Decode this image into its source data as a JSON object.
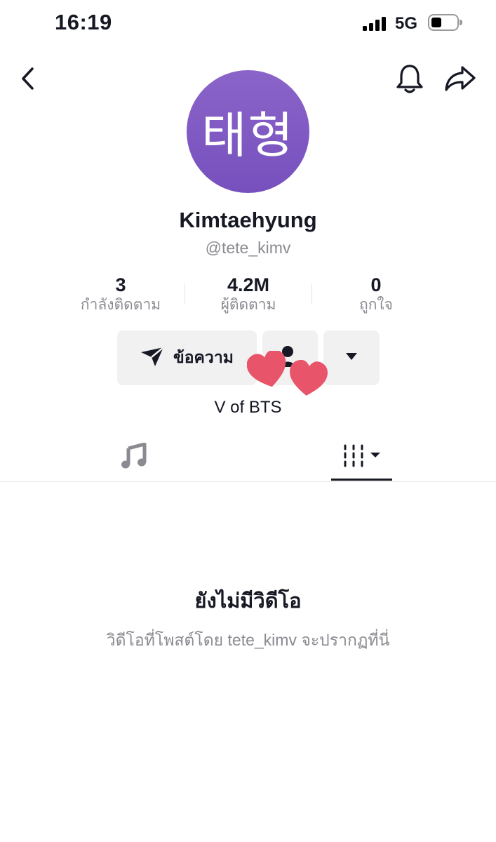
{
  "status_bar": {
    "time": "16:19",
    "network": "5G",
    "icons": [
      "signal-bars-icon",
      "battery-icon"
    ]
  },
  "header": {
    "icons": [
      "back-chevron-icon",
      "bell-icon",
      "share-arrow-icon"
    ]
  },
  "profile": {
    "avatar_text": "태형",
    "avatar_color": "#7d57c2",
    "display_name": "Kimtaehyung",
    "handle": "@tete_kimv",
    "bio": "V of BTS"
  },
  "stats": [
    {
      "value": "3",
      "label": "กำลังติดตาม"
    },
    {
      "value": "4.2M",
      "label": "ผู้ติดตาม"
    },
    {
      "value": "0",
      "label": "ถูกใจ"
    }
  ],
  "actions": {
    "message_label": "ข้อความ",
    "icons": [
      "paper-plane-icon",
      "follow-person-icon",
      "caret-down-icon"
    ]
  },
  "stickers": {
    "type": "heart-sticker",
    "color": "#e8546a"
  },
  "tabs": {
    "items": [
      "music-note-icon",
      "grid-tab-icon"
    ],
    "active": "grid-tab-icon"
  },
  "empty_state": {
    "title": "ยังไม่มีวิดีโอ",
    "subtitle": "วิดีโอที่โพสต์โดย tete_kimv จะปรากฏที่นี่"
  }
}
